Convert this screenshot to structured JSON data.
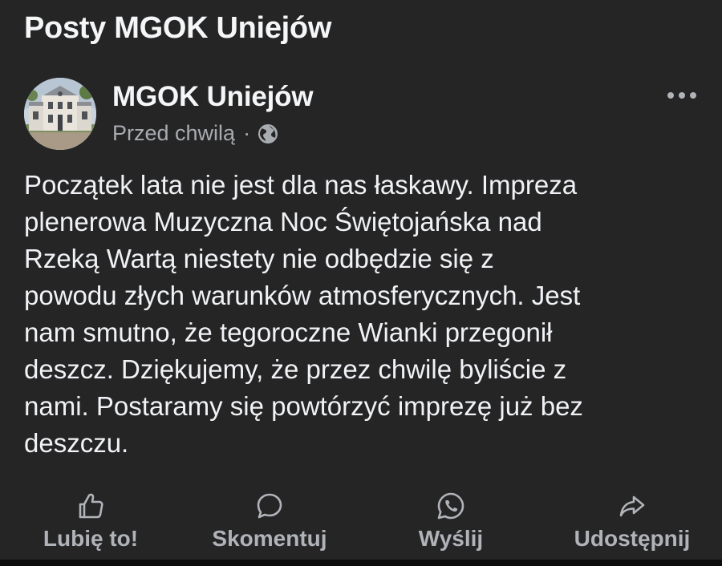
{
  "page": {
    "section_title": "Posty MGOK Uniejów"
  },
  "post": {
    "author": "MGOK Uniejów",
    "time": "Przed chwilą",
    "separator": "·",
    "audience_icon": "globe-icon",
    "text": "Początek lata nie jest dla nas łaskawy. Impreza\nplenerowa Muzyczna Noc Świętojańska nad\nRzeką Wartą niestety nie odbędzie się z\npowodu złych warunków atmosferycznych. Jest\nnam smutno, że tegoroczne Wianki przegonił\ndeszcz. Dziękujemy, że przez chwilę byliście z\nnami. Postaramy się powtórzyć imprezę już bez\ndeszczu."
  },
  "actions": {
    "like": {
      "label": "Lubię to!",
      "icon": "thumbs-up-icon"
    },
    "comment": {
      "label": "Skomentuj",
      "icon": "comment-icon"
    },
    "send": {
      "label": "Wyślij",
      "icon": "whatsapp-icon"
    },
    "share": {
      "label": "Udostępnij",
      "icon": "share-arrow-icon"
    }
  },
  "colors": {
    "background": "#252526",
    "text": "#f0f2f5",
    "secondary_text": "#a8abaf",
    "action_text": "#b0b3b8"
  }
}
